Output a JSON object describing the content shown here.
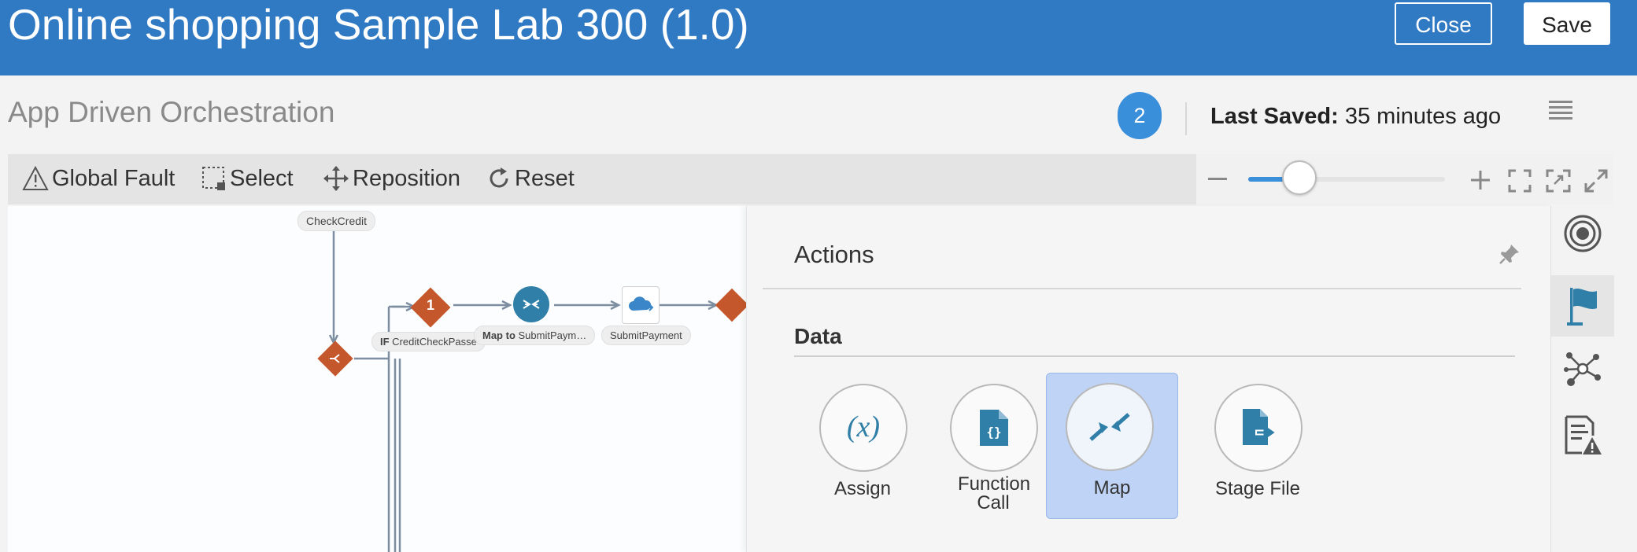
{
  "header": {
    "title": "Online shopping Sample Lab 300 (1.0)",
    "close_label": "Close",
    "save_label": "Save"
  },
  "subheader": {
    "title": "App Driven Orchestration",
    "badge_count": "2",
    "last_saved_label": "Last Saved:",
    "last_saved_value": " 35 minutes ago"
  },
  "toolbar": {
    "global_fault": "Global Fault",
    "select": "Select",
    "reposition": "Reposition",
    "reset": "Reset",
    "zoom_level": 0.13
  },
  "canvas": {
    "nodes": {
      "check_credit": "CheckCredit",
      "if_condition_prefix": "IF",
      "if_condition": " CreditCheckPasse",
      "branch_number": "1",
      "map_prefix": "Map to",
      "map_target": " SubmitPaym…",
      "submit_payment": "SubmitPayment"
    },
    "colors": {
      "switch": "#c4572b",
      "map": "#2f7fa8",
      "line": "#7d8ea0"
    }
  },
  "actions_panel": {
    "title": "Actions",
    "section": "Data",
    "items": [
      {
        "label": "Assign",
        "icon": "assign-icon"
      },
      {
        "label": "Function Call",
        "icon": "function-call-icon"
      },
      {
        "label": "Map",
        "icon": "map-icon",
        "selected": true
      },
      {
        "label": "Stage File",
        "icon": "stage-file-icon"
      }
    ],
    "accent": "#2f7fa8"
  },
  "rail": {
    "items": [
      "target-icon",
      "flag-icon",
      "network-icon",
      "report-warning-icon"
    ]
  }
}
